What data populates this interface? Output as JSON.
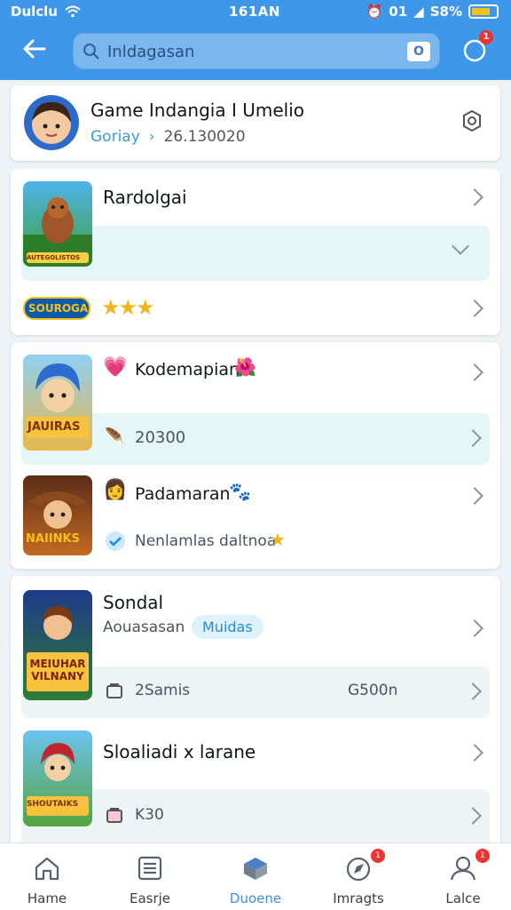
{
  "status": {
    "left": "Dulclu",
    "time": "161AN",
    "right": "01",
    "battery": "S8%"
  },
  "search": {
    "placeholder": "Inldagasan",
    "badge": "O"
  },
  "header": {
    "notification_count": "1"
  },
  "profile": {
    "title": "Game Indangia I Umelio",
    "link": "Goriay",
    "id": "26.130020"
  },
  "group1": {
    "title": "Rardolgai",
    "logo_text": "SOUROGA",
    "stars": 3,
    "thumb_text": "AUTEGOLISTOS"
  },
  "group2": {
    "title": "Kodemapian",
    "thumb_text": "JAUIRAS",
    "sub_value": "20300",
    "item2_title": "Padamaran",
    "item2_thumb_text": "NAIINKS",
    "item2_sub": "Nenlamlas daltnoa"
  },
  "group3": {
    "title": "Sondal",
    "sub": "Aouasasan",
    "tag": "Muidas",
    "thumb_text": "MEIUHAR VILNANY",
    "row_left": "2Samis",
    "row_right": "G500n",
    "item2_title": "Sloaliadi x larane",
    "item2_thumb_text": "SHOUTAIKS",
    "item2_sub": "K30"
  },
  "tabs": [
    {
      "label": "Hame"
    },
    {
      "label": "Easrje"
    },
    {
      "label": "Duoene"
    },
    {
      "label": "Imragts",
      "badge": "1"
    },
    {
      "label": "Lalce",
      "badge": "1"
    }
  ],
  "colors": {
    "accent": "#3f97ea",
    "active_tab": "#3f8fe0",
    "badge": "#e33333"
  }
}
